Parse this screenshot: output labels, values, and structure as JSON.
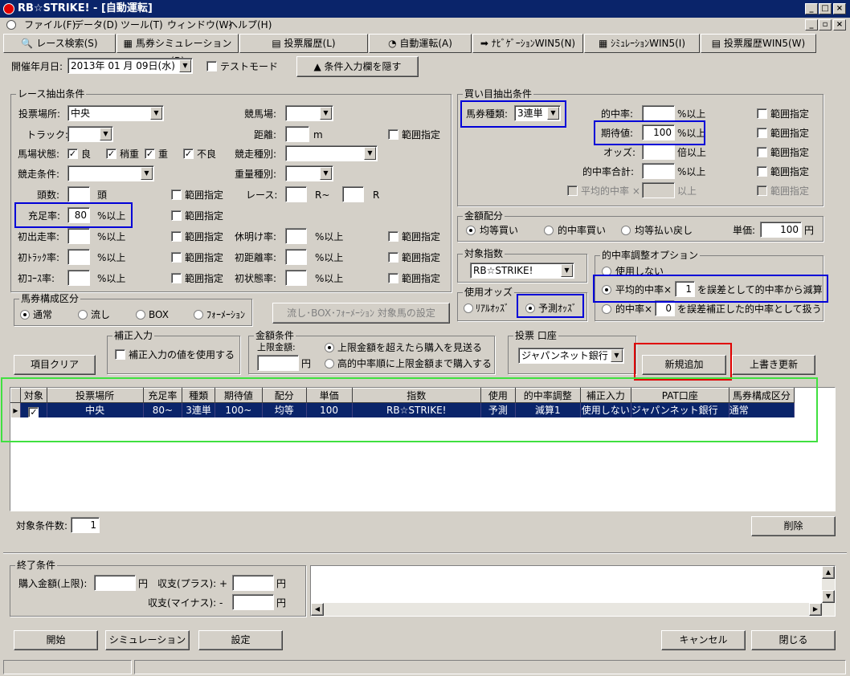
{
  "window": {
    "title": "RB☆STRIKE! - [自動運転]"
  },
  "menu": [
    "ファイル(F)",
    "データ(D)",
    "ツール(T)",
    "ウィンドウ(W)",
    "ヘルプ(H)"
  ],
  "tabs": [
    "レース検索(S)",
    "馬券シミュレーション(B)",
    "投票履歴(L)",
    "自動運転(A)",
    "ﾅﾋﾞｹﾞｰｼｮﾝWIN5(N)",
    "ｼﾐｭﾚｰｼｮﾝWIN5(I)",
    "投票履歴WIN5(W)"
  ],
  "toolbar": {
    "date_label": "開催年月日:",
    "date_value": "2013年 01 月 09日(水)",
    "test_mode": "テストモード",
    "hide_button": "▲ 条件入力欄を隠す"
  },
  "race": {
    "title": "レース抽出条件",
    "venue_label": "投票場所:",
    "venue_value": "中央",
    "racecourse_label": "競馬場:",
    "track_label": "トラック:",
    "distance_label": "距離:",
    "distance_unit": "m",
    "range": "範囲指定",
    "condition_label": "馬場状態:",
    "cond_good": "良",
    "cond_slight": "稍重",
    "cond_heavy": "重",
    "cond_bad": "不良",
    "race_type_label": "競走種別:",
    "race_cond_label": "競走条件:",
    "weight_label": "重量種別:",
    "heads_label": "頭数:",
    "heads_unit": "頭",
    "race_label": "レース:",
    "race_from": "R~",
    "race_to": "R",
    "fill_label": "充足率:",
    "fill_value": "80",
    "pct_over": "%以上",
    "first_label": "初出走率:",
    "rest_label": "休明け率:",
    "first_track_label": "初ﾄﾗｯｸ率:",
    "first_dist_label": "初距離率:",
    "first_course_label": "初ｺｰｽ率:",
    "first_cond_label": "初状態率:"
  },
  "buy": {
    "title": "買い目抽出条件",
    "type_label": "馬券種類:",
    "type_value": "3連単",
    "hit_label": "的中率:",
    "exp_label": "期待値:",
    "exp_value": "100",
    "odds_label": "オッズ:",
    "odds_unit": "倍以上",
    "hit_sum_label": "的中率合計:",
    "avg_hit_label": "平均的中率 ×",
    "under": "以上",
    "pct_over": "%以上",
    "range": "範囲指定"
  },
  "money": {
    "title": "金額配分",
    "opt1": "均等買い",
    "opt2": "的中率買い",
    "opt3": "均等払い戻し",
    "unit_label": "単価:",
    "unit_value": "100",
    "yen": "円"
  },
  "index": {
    "title": "対象指数",
    "value": "RB☆STRIKE!"
  },
  "odds": {
    "title": "使用オッズ",
    "opt1": "ﾘｱﾙｵｯｽﾞ",
    "opt2": "予測ｵｯｽﾞ"
  },
  "adjust": {
    "title": "的中率調整オプション",
    "opt1": "使用しない",
    "opt2a": "平均的中率×",
    "opt2v": "1",
    "opt2b": "を誤差として的中率から減算",
    "opt3a": "的中率×",
    "opt3v": "0",
    "opt3b": "を誤差補正した的中率として扱う"
  },
  "horse_comp": {
    "title": "馬券構成区分",
    "opt1": "通常",
    "opt2": "流し",
    "opt3": "BOX",
    "opt4": "ﾌｫｰﾒｰｼｮﾝ",
    "setting_button": "流し･BOX･ﾌｫｰﾒｰｼｮﾝ 対象馬の設定"
  },
  "correction": {
    "title": "補正入力",
    "use": "補正入力の値を使用する"
  },
  "amount": {
    "title": "金額条件",
    "limit_label": "上限金額:",
    "yen": "円",
    "opt1": "上限金額を超えたら購入を見送る",
    "opt2": "高的中率順に上限金額まで購入する"
  },
  "account": {
    "title": "投票 口座",
    "value": "ジャパンネット銀行"
  },
  "buttons": {
    "clear": "項目クリア",
    "add": "新規追加",
    "overwrite": "上書き更新",
    "delete": "削除",
    "start": "開始",
    "simulation": "シミュレーション",
    "settings": "設定",
    "cancel": "キャンセル",
    "close": "閉じる"
  },
  "table": {
    "headers": [
      "対象",
      "投票場所",
      "充足率",
      "種類",
      "期待値",
      "配分",
      "単価",
      "指数",
      "使用",
      "的中率調整",
      "補正入力",
      "PAT口座",
      "馬券構成区分"
    ],
    "row": [
      "✓",
      "中央",
      "80~",
      "3連単",
      "100~",
      "均等",
      "100",
      "RB☆STRIKE!",
      "予測",
      "減算1",
      "使用しない",
      "ジャパンネット銀行",
      "通常"
    ]
  },
  "count": {
    "label": "対象条件数:",
    "value": "1"
  },
  "end": {
    "title": "終了条件",
    "buy_label": "購入金額(上限):",
    "yen": "円",
    "plus_label": "収支(プラス): +",
    "minus_label": "収支(マイナス): -"
  }
}
